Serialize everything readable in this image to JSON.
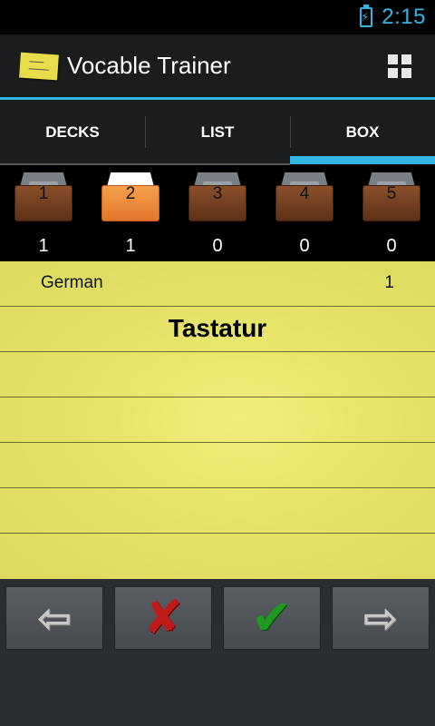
{
  "status_bar": {
    "time": "2:15",
    "battery_icon": "battery-charging-icon"
  },
  "action_bar": {
    "title": "Vocable Trainer",
    "logo_icon": "sticky-note-icon",
    "menu_icon": "grid-icon"
  },
  "tabs": [
    {
      "label": "DECKS",
      "selected": false
    },
    {
      "label": "LIST",
      "selected": false
    },
    {
      "label": "BOX",
      "selected": true
    }
  ],
  "boxes": [
    {
      "number": "1",
      "count": "1",
      "active": false
    },
    {
      "number": "2",
      "count": "1",
      "active": true
    },
    {
      "number": "3",
      "count": "0",
      "active": false
    },
    {
      "number": "4",
      "count": "0",
      "active": false
    },
    {
      "number": "5",
      "count": "0",
      "active": false
    }
  ],
  "card": {
    "deck_name": "German",
    "deck_count": "1",
    "word": "Tastatur"
  },
  "buttons": {
    "previous_icon": "arrow-left-icon",
    "wrong_icon": "cross-icon",
    "right_icon": "check-icon",
    "next_icon": "arrow-right-icon"
  },
  "colors": {
    "accent": "#33b5e5",
    "note": "#e6e36a",
    "wrong": "#c01a1a",
    "right": "#1f9a1f"
  }
}
